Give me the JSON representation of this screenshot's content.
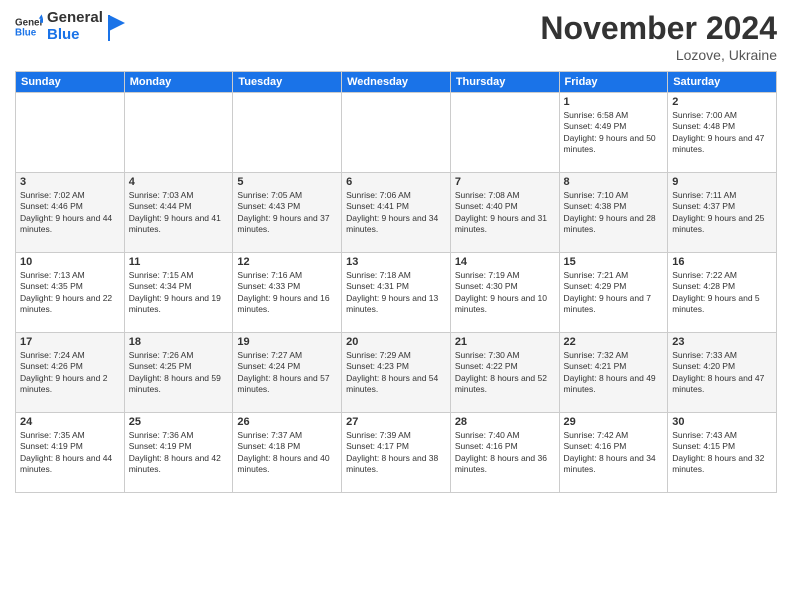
{
  "header": {
    "logo_text_general": "General",
    "logo_text_blue": "Blue",
    "title": "November 2024",
    "subtitle": "Lozove, Ukraine"
  },
  "days_of_week": [
    "Sunday",
    "Monday",
    "Tuesday",
    "Wednesday",
    "Thursday",
    "Friday",
    "Saturday"
  ],
  "weeks": [
    {
      "cells": [
        {
          "day": null
        },
        {
          "day": null
        },
        {
          "day": null
        },
        {
          "day": null
        },
        {
          "day": null
        },
        {
          "day": 1,
          "sunrise": "Sunrise: 6:58 AM",
          "sunset": "Sunset: 4:49 PM",
          "daylight": "Daylight: 9 hours and 50 minutes."
        },
        {
          "day": 2,
          "sunrise": "Sunrise: 7:00 AM",
          "sunset": "Sunset: 4:48 PM",
          "daylight": "Daylight: 9 hours and 47 minutes."
        }
      ]
    },
    {
      "cells": [
        {
          "day": 3,
          "sunrise": "Sunrise: 7:02 AM",
          "sunset": "Sunset: 4:46 PM",
          "daylight": "Daylight: 9 hours and 44 minutes."
        },
        {
          "day": 4,
          "sunrise": "Sunrise: 7:03 AM",
          "sunset": "Sunset: 4:44 PM",
          "daylight": "Daylight: 9 hours and 41 minutes."
        },
        {
          "day": 5,
          "sunrise": "Sunrise: 7:05 AM",
          "sunset": "Sunset: 4:43 PM",
          "daylight": "Daylight: 9 hours and 37 minutes."
        },
        {
          "day": 6,
          "sunrise": "Sunrise: 7:06 AM",
          "sunset": "Sunset: 4:41 PM",
          "daylight": "Daylight: 9 hours and 34 minutes."
        },
        {
          "day": 7,
          "sunrise": "Sunrise: 7:08 AM",
          "sunset": "Sunset: 4:40 PM",
          "daylight": "Daylight: 9 hours and 31 minutes."
        },
        {
          "day": 8,
          "sunrise": "Sunrise: 7:10 AM",
          "sunset": "Sunset: 4:38 PM",
          "daylight": "Daylight: 9 hours and 28 minutes."
        },
        {
          "day": 9,
          "sunrise": "Sunrise: 7:11 AM",
          "sunset": "Sunset: 4:37 PM",
          "daylight": "Daylight: 9 hours and 25 minutes."
        }
      ]
    },
    {
      "cells": [
        {
          "day": 10,
          "sunrise": "Sunrise: 7:13 AM",
          "sunset": "Sunset: 4:35 PM",
          "daylight": "Daylight: 9 hours and 22 minutes."
        },
        {
          "day": 11,
          "sunrise": "Sunrise: 7:15 AM",
          "sunset": "Sunset: 4:34 PM",
          "daylight": "Daylight: 9 hours and 19 minutes."
        },
        {
          "day": 12,
          "sunrise": "Sunrise: 7:16 AM",
          "sunset": "Sunset: 4:33 PM",
          "daylight": "Daylight: 9 hours and 16 minutes."
        },
        {
          "day": 13,
          "sunrise": "Sunrise: 7:18 AM",
          "sunset": "Sunset: 4:31 PM",
          "daylight": "Daylight: 9 hours and 13 minutes."
        },
        {
          "day": 14,
          "sunrise": "Sunrise: 7:19 AM",
          "sunset": "Sunset: 4:30 PM",
          "daylight": "Daylight: 9 hours and 10 minutes."
        },
        {
          "day": 15,
          "sunrise": "Sunrise: 7:21 AM",
          "sunset": "Sunset: 4:29 PM",
          "daylight": "Daylight: 9 hours and 7 minutes."
        },
        {
          "day": 16,
          "sunrise": "Sunrise: 7:22 AM",
          "sunset": "Sunset: 4:28 PM",
          "daylight": "Daylight: 9 hours and 5 minutes."
        }
      ]
    },
    {
      "cells": [
        {
          "day": 17,
          "sunrise": "Sunrise: 7:24 AM",
          "sunset": "Sunset: 4:26 PM",
          "daylight": "Daylight: 9 hours and 2 minutes."
        },
        {
          "day": 18,
          "sunrise": "Sunrise: 7:26 AM",
          "sunset": "Sunset: 4:25 PM",
          "daylight": "Daylight: 8 hours and 59 minutes."
        },
        {
          "day": 19,
          "sunrise": "Sunrise: 7:27 AM",
          "sunset": "Sunset: 4:24 PM",
          "daylight": "Daylight: 8 hours and 57 minutes."
        },
        {
          "day": 20,
          "sunrise": "Sunrise: 7:29 AM",
          "sunset": "Sunset: 4:23 PM",
          "daylight": "Daylight: 8 hours and 54 minutes."
        },
        {
          "day": 21,
          "sunrise": "Sunrise: 7:30 AM",
          "sunset": "Sunset: 4:22 PM",
          "daylight": "Daylight: 8 hours and 52 minutes."
        },
        {
          "day": 22,
          "sunrise": "Sunrise: 7:32 AM",
          "sunset": "Sunset: 4:21 PM",
          "daylight": "Daylight: 8 hours and 49 minutes."
        },
        {
          "day": 23,
          "sunrise": "Sunrise: 7:33 AM",
          "sunset": "Sunset: 4:20 PM",
          "daylight": "Daylight: 8 hours and 47 minutes."
        }
      ]
    },
    {
      "cells": [
        {
          "day": 24,
          "sunrise": "Sunrise: 7:35 AM",
          "sunset": "Sunset: 4:19 PM",
          "daylight": "Daylight: 8 hours and 44 minutes."
        },
        {
          "day": 25,
          "sunrise": "Sunrise: 7:36 AM",
          "sunset": "Sunset: 4:19 PM",
          "daylight": "Daylight: 8 hours and 42 minutes."
        },
        {
          "day": 26,
          "sunrise": "Sunrise: 7:37 AM",
          "sunset": "Sunset: 4:18 PM",
          "daylight": "Daylight: 8 hours and 40 minutes."
        },
        {
          "day": 27,
          "sunrise": "Sunrise: 7:39 AM",
          "sunset": "Sunset: 4:17 PM",
          "daylight": "Daylight: 8 hours and 38 minutes."
        },
        {
          "day": 28,
          "sunrise": "Sunrise: 7:40 AM",
          "sunset": "Sunset: 4:16 PM",
          "daylight": "Daylight: 8 hours and 36 minutes."
        },
        {
          "day": 29,
          "sunrise": "Sunrise: 7:42 AM",
          "sunset": "Sunset: 4:16 PM",
          "daylight": "Daylight: 8 hours and 34 minutes."
        },
        {
          "day": 30,
          "sunrise": "Sunrise: 7:43 AM",
          "sunset": "Sunset: 4:15 PM",
          "daylight": "Daylight: 8 hours and 32 minutes."
        }
      ]
    }
  ]
}
